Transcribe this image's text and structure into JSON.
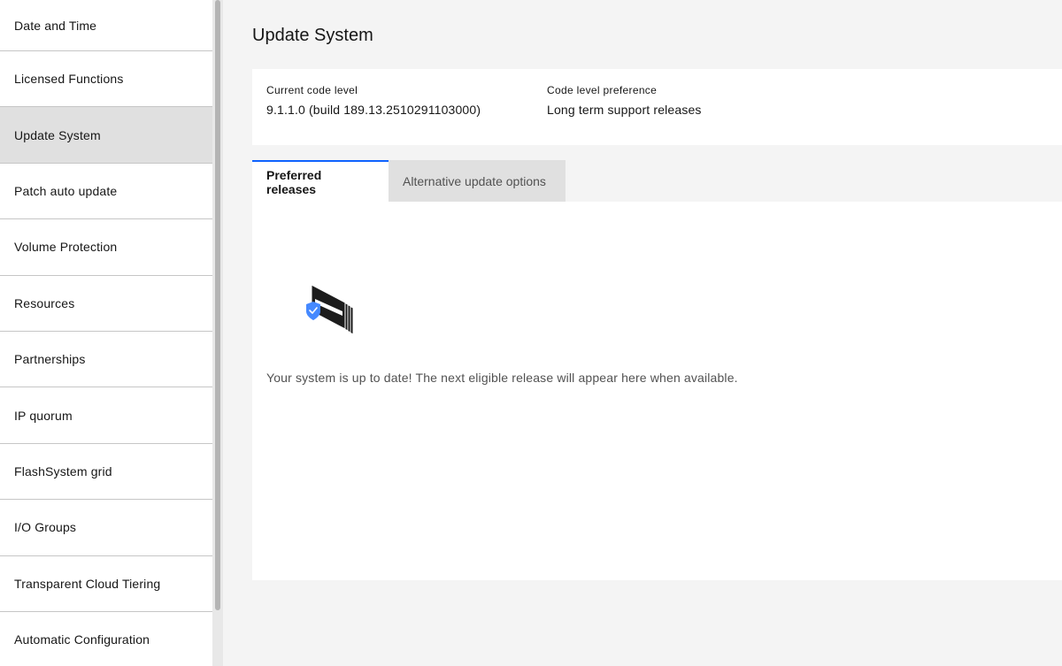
{
  "sidebar": {
    "items": [
      {
        "label": "Date and Time"
      },
      {
        "label": "Licensed Functions"
      },
      {
        "label": "Update System"
      },
      {
        "label": "Patch auto update"
      },
      {
        "label": "Volume Protection"
      },
      {
        "label": "Resources"
      },
      {
        "label": "Partnerships"
      },
      {
        "label": "IP quorum"
      },
      {
        "label": "FlashSystem grid"
      },
      {
        "label": "I/O Groups"
      },
      {
        "label": "Transparent Cloud Tiering"
      },
      {
        "label": "Automatic Configuration"
      }
    ],
    "active": "Update System"
  },
  "page": {
    "title": "Update System"
  },
  "info": {
    "current_code_label": "Current code level",
    "current_code_value": "9.1.1.0 (build 189.13.2510291103000)",
    "preference_label": "Code level preference",
    "preference_value": "Long term support releases"
  },
  "tabs": [
    {
      "label": "Preferred releases",
      "selected": true
    },
    {
      "label": "Alternative update options",
      "selected": false
    }
  ],
  "panel": {
    "icon": "system-up-to-date-icon",
    "message": "Your system is up to date! The next eligible release will appear here when available."
  },
  "colors": {
    "accent": "#0f62fe",
    "shield": "#4589ff"
  }
}
